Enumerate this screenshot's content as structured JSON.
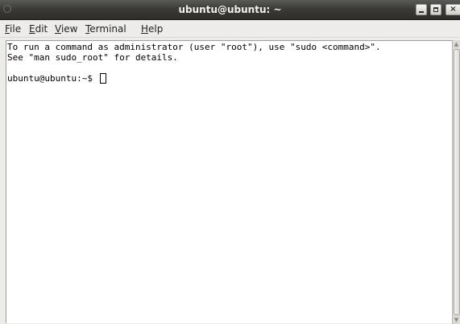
{
  "window": {
    "title": "ubuntu@ubuntu: ~",
    "controls": {
      "minimize": "minimize-icon",
      "maximize": "maximize-icon",
      "close": "close-icon",
      "close_glyph": "×"
    }
  },
  "menubar": {
    "items": [
      {
        "mnemonic": "F",
        "rest": "ile"
      },
      {
        "mnemonic": "E",
        "rest": "dit"
      },
      {
        "mnemonic": "V",
        "rest": "iew"
      },
      {
        "mnemonic": "T",
        "rest": "erminal"
      },
      {
        "mnemonic": "H",
        "rest": "elp"
      }
    ]
  },
  "terminal": {
    "lines": [
      "To run a command as administrator (user \"root\"), use \"sudo <command>\".",
      "See \"man sudo_root\" for details."
    ],
    "prompt": "ubuntu@ubuntu:~$ "
  },
  "scrollbar": {
    "up_glyph": "▲",
    "down_glyph": "▼"
  }
}
